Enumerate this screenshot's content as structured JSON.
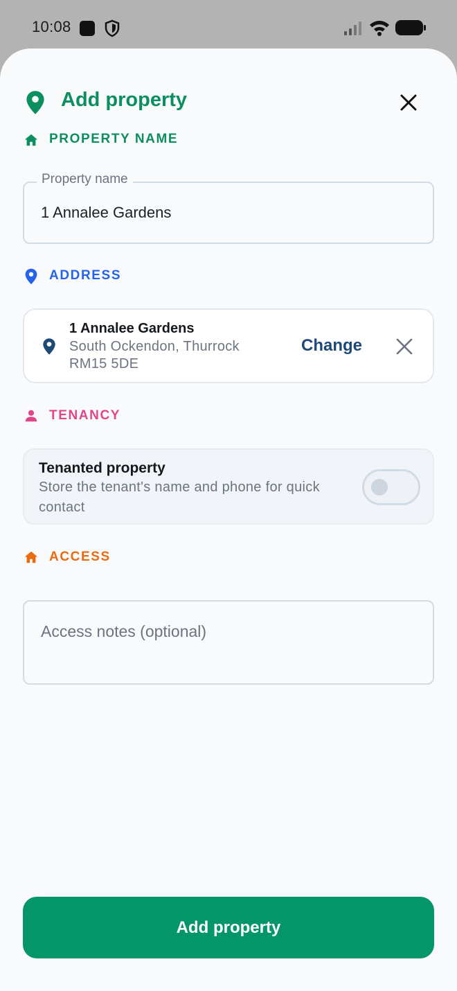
{
  "status_bar": {
    "time": "10:08"
  },
  "header": {
    "title": "Add property"
  },
  "sections": {
    "property_name": {
      "label": "PROPERTY NAME",
      "color": "#0b8f5f"
    },
    "address": {
      "label": "ADDRESS",
      "color": "#2563eb"
    },
    "tenancy": {
      "label": "TENANCY",
      "color": "#e0458a"
    },
    "access": {
      "label": "ACCESS",
      "color": "#ea6a12"
    }
  },
  "property_name_field": {
    "legend": "Property name",
    "value": "1 Annalee Gardens"
  },
  "address_card": {
    "line1": "1 Annalee Gardens",
    "line2": "South Ockendon, Thurrock",
    "line3": "RM15 5DE",
    "change_label": "Change"
  },
  "tenancy_card": {
    "title": "Tenanted property",
    "description": "Store the tenant's name and phone for quick contact",
    "toggle_on": false
  },
  "access_field": {
    "placeholder": "Access notes (optional)",
    "value": ""
  },
  "submit": {
    "label": "Add property"
  },
  "icons": {
    "header": "map-pin-icon",
    "close": "close-icon",
    "property_name": "home-icon",
    "address": "map-pin-icon",
    "tenancy": "person-icon",
    "access": "home-icon",
    "clear_address": "close-icon"
  }
}
